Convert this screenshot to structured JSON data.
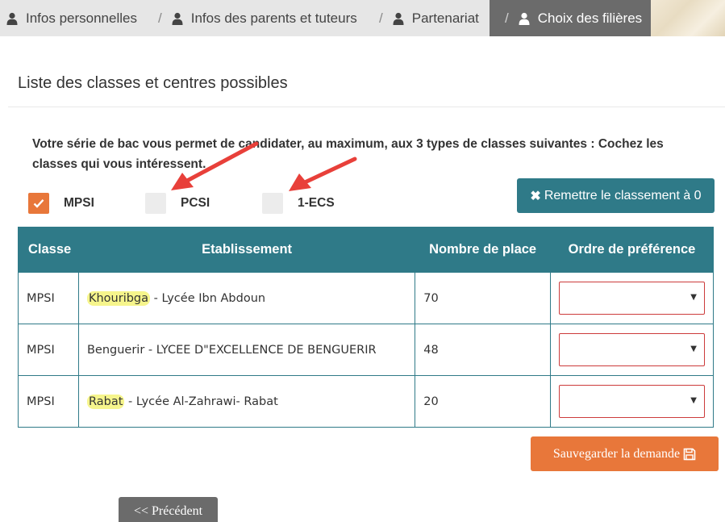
{
  "steps": [
    {
      "label": "Infos personnelles",
      "active": false
    },
    {
      "label": "Infos des parents et tuteurs",
      "active": false
    },
    {
      "label": "Partenariat",
      "active": false
    },
    {
      "label": "Choix des filières",
      "active": true
    }
  ],
  "steps_separator": "/",
  "section_title": "Liste des classes et centres possibles",
  "intro_text": "Votre série de bac vous permet de candidater, au maximum, aux 3 types de classes suivantes : Cochez les classes qui vous intéressent.",
  "class_options": [
    {
      "label": "MPSI",
      "checked": true
    },
    {
      "label": "PCSI",
      "checked": false
    },
    {
      "label": "1-ECS",
      "checked": false
    }
  ],
  "reset_button": {
    "icon": "times-icon",
    "label": "Remettre le classement à 0"
  },
  "table": {
    "headers": [
      "Classe",
      "Etablissement",
      "Nombre de place",
      "Ordre de préférence"
    ],
    "rows": [
      {
        "classe": "MPSI",
        "city": "Khouribga",
        "school": " - Lycée Ibn Abdoun",
        "places": "70",
        "order": ""
      },
      {
        "classe": "MPSI",
        "city": "Benguerir",
        "school": " - LYCEE D\"EXCELLENCE DE BENGUERIR",
        "places": "48",
        "order": ""
      },
      {
        "classe": "MPSI",
        "city": "Rabat",
        "school": " - Lycée Al-Zahrawi- Rabat",
        "places": "20",
        "order": ""
      }
    ]
  },
  "save_button": {
    "label": "Sauvegarder la demande",
    "icon": "floppy-disk-icon"
  },
  "prev_button": {
    "label": "<< Précédent"
  },
  "colors": {
    "accent_teal": "#2f7a88",
    "accent_orange": "#e8773a",
    "highlight": "#f6f58c",
    "annotation_red": "#e8403a"
  }
}
